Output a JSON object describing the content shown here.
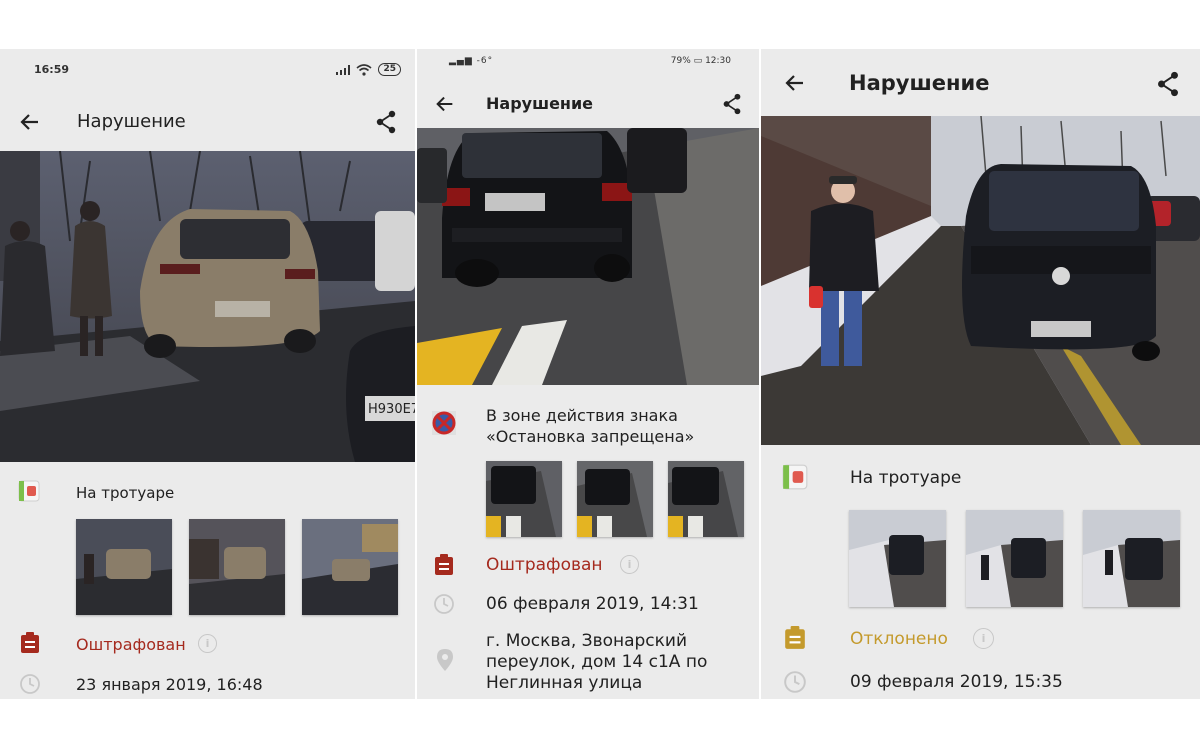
{
  "screens": [
    {
      "status_time": "16:59",
      "battery": "25",
      "title": "Нарушение",
      "violation_type": "На тротуаре",
      "status": "Оштрафован",
      "date": "23 января 2019, 16:48",
      "plate": "Н930Е7"
    },
    {
      "status_left": "-6°",
      "battery_pct": "79%",
      "status_time": "12:30",
      "title": "Нарушение",
      "violation_type": "В зоне действия знака «Остановка запрещена»",
      "status": "Оштрафован",
      "date": "06 февраля 2019, 14:31",
      "address": "г. Москва, Звонарский переулок, дом 14 с1А по Неглинная улица"
    },
    {
      "title": "Нарушение",
      "violation_type": "На тротуаре",
      "status": "Отклонено",
      "date": "09 февраля 2019, 15:35"
    }
  ],
  "colors": {
    "fined": "#a52a1e",
    "rejected": "#c49a2c",
    "background": "#ebebeb"
  },
  "icons": [
    "back-arrow-icon",
    "share-icon",
    "sidewalk-icon",
    "no-stopping-sign-icon",
    "clipboard-icon",
    "clock-icon",
    "location-pin-icon",
    "info-icon"
  ]
}
